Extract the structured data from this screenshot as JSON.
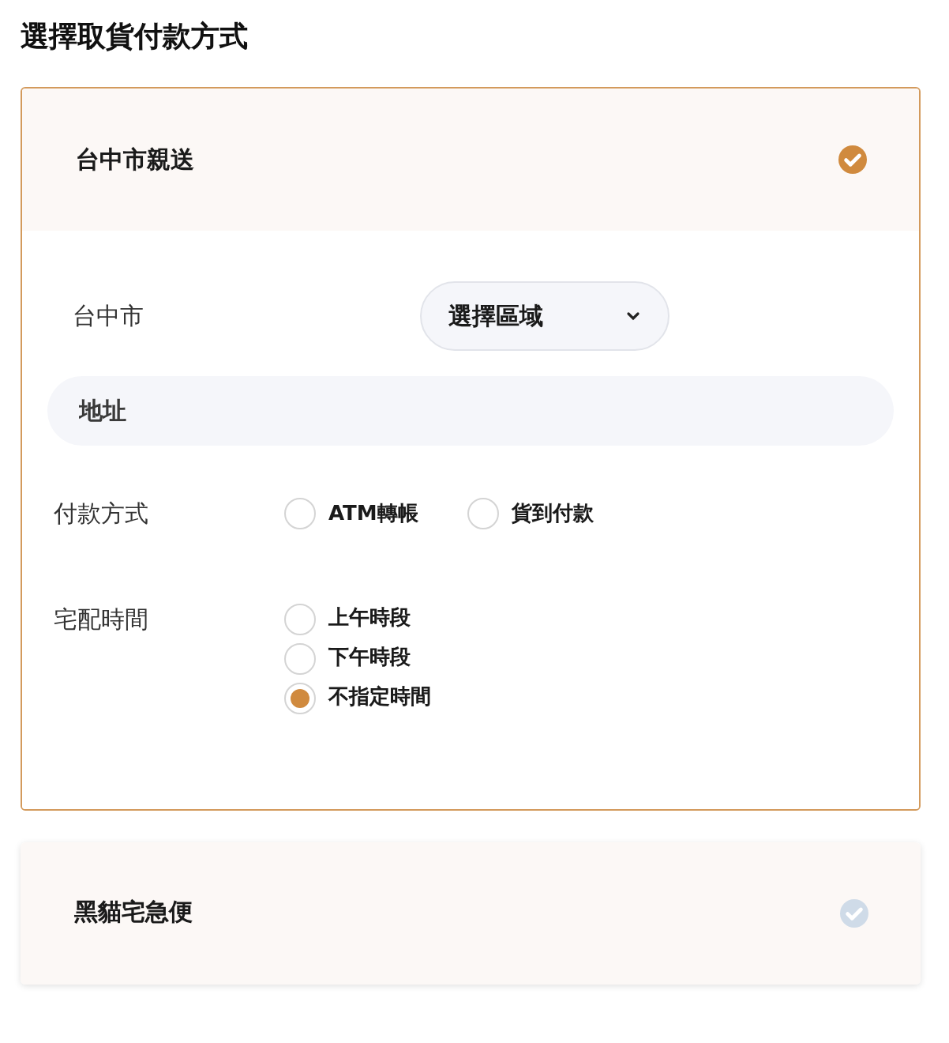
{
  "title": "選擇取貨付款方式",
  "methods": [
    {
      "name": "台中市親送",
      "selected": true,
      "expanded": true,
      "city": "台中市",
      "district": {
        "value": "選擇區域"
      },
      "address": {
        "placeholder": "地址"
      },
      "payment": {
        "label": "付款方式",
        "options": [
          {
            "label": "ATM轉帳",
            "selected": false
          },
          {
            "label": "貨到付款",
            "selected": false
          }
        ]
      },
      "delivery_time": {
        "label": "宅配時間",
        "options": [
          {
            "label": "上午時段",
            "selected": false
          },
          {
            "label": "下午時段",
            "selected": false
          },
          {
            "label": "不指定時間",
            "selected": true
          }
        ]
      }
    },
    {
      "name": "黑貓宅急便",
      "selected": false,
      "expanded": false
    }
  ]
}
